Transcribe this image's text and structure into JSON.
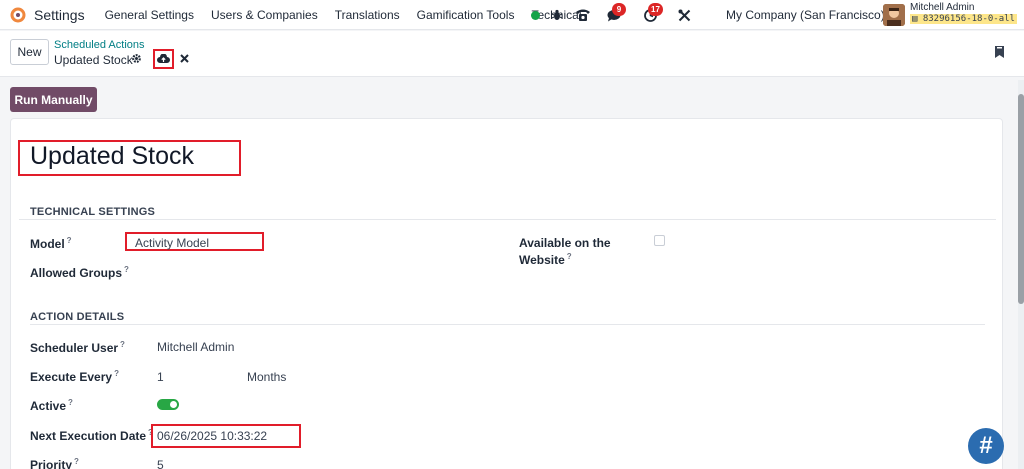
{
  "navbar": {
    "app_title": "Settings",
    "menu": [
      "General Settings",
      "Users & Companies",
      "Translations",
      "Gamification Tools",
      "Technical"
    ],
    "messages_count": "9",
    "activities_count": "17",
    "company": "My Company (San Francisco)",
    "user_name": "Mitchell Admin",
    "database": "83296156-18-0-all"
  },
  "control": {
    "new_label": "New",
    "breadcrumb_parent": "Scheduled Actions",
    "record_name": "Updated Stock"
  },
  "actions": {
    "run_manually": "Run Manually"
  },
  "form": {
    "title": "Updated Stock",
    "technical_settings": {
      "heading": "TECHNICAL SETTINGS",
      "model_label": "Model",
      "model_value": "Activity Model",
      "allowed_groups_label": "Allowed Groups",
      "available_website_label_1": "Available on the",
      "available_website_label_2": "Website",
      "available_website_checked": false
    },
    "action_details": {
      "heading": "ACTION DETAILS",
      "scheduler_user_label": "Scheduler User",
      "scheduler_user_value": "Mitchell Admin",
      "execute_every_label": "Execute Every",
      "execute_every_value": "1",
      "execute_every_unit": "Months",
      "active_label": "Active",
      "active_on": true,
      "next_execution_label": "Next Execution Date",
      "next_execution_value": "06/26/2025 10:33:22",
      "priority_label": "Priority",
      "priority_value": "5"
    },
    "help_mark": "?"
  },
  "fab_label": "#",
  "colors": {
    "accent": "#714b67",
    "link": "#017e84",
    "highlight": "#e11d2a",
    "toggle": "#28a745"
  }
}
